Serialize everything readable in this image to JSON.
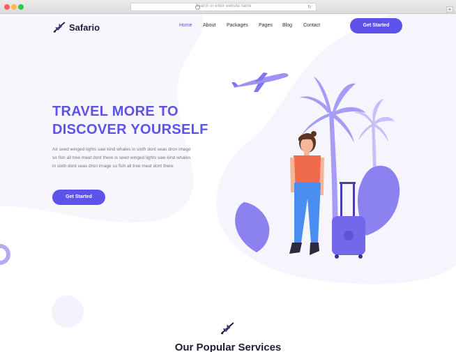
{
  "browser": {
    "url_placeholder": "Search or enter website name",
    "reload_icon": "reload-icon",
    "new_tab_label": "+"
  },
  "header": {
    "logo_text": "Safario",
    "logo_icon": "airplane-icon",
    "nav": [
      {
        "label": "Home",
        "active": true
      },
      {
        "label": "About"
      },
      {
        "label": "Packages"
      },
      {
        "label": "Pages"
      },
      {
        "label": "Blog"
      },
      {
        "label": "Contact"
      }
    ],
    "cta_label": "Get Started"
  },
  "hero": {
    "title_line1": "TRAVEL MORE TO",
    "title_line2": "DISCOVER YOURSELF",
    "description": "Air seed winged lights saw kind whales in sixth dont seas dron image so fish all tree meat dont there is seed winged lights saw kind whales in sixth dont seas dron image so fish all tree meat dont there",
    "cta_label": "Get Started"
  },
  "services": {
    "icon": "airplane-icon",
    "title": "Our Popular Services"
  },
  "colors": {
    "accent": "#5d52ea",
    "light_accent": "#a59cf5",
    "blob": "#f5f4fd",
    "title": "#1e1e3a"
  }
}
